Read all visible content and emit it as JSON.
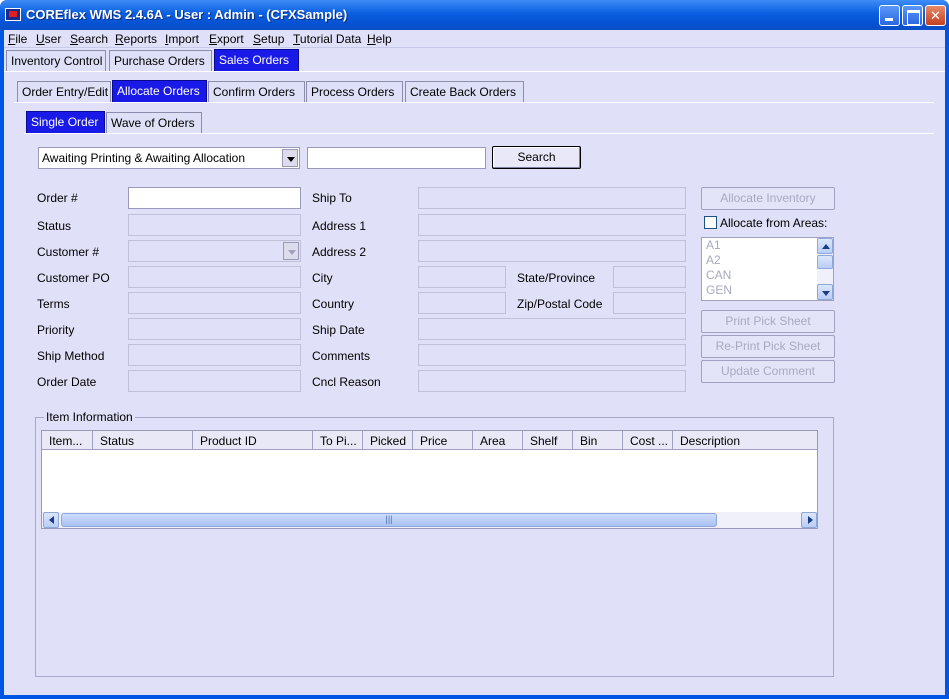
{
  "window": {
    "title": "COREflex WMS 2.4.6A - User : Admin - (CFXSample)"
  },
  "menu": [
    "File",
    "User",
    "Search",
    "Reports",
    "Import",
    "Export",
    "Setup",
    "Tutorial Data",
    "Help"
  ],
  "main_tabs": [
    "Inventory Control",
    "Purchase Orders",
    "Sales Orders"
  ],
  "sub_tabs": [
    "Order Entry/Edit",
    "Allocate Orders",
    "Confirm Orders",
    "Process Orders",
    "Create Back Orders"
  ],
  "mode_tabs": [
    "Single Order",
    "Wave of Orders"
  ],
  "search": {
    "filter_value": "Awaiting Printing & Awaiting Allocation",
    "query_value": "",
    "button": "Search"
  },
  "form": {
    "order_num": "Order #",
    "status": "Status",
    "customer_num": "Customer #",
    "customer_po": "Customer PO",
    "terms": "Terms",
    "priority": "Priority",
    "ship_method": "Ship Method",
    "order_date": "Order Date",
    "ship_to": "Ship To",
    "address1": "Address 1",
    "address2": "Address 2",
    "city": "City",
    "country": "Country",
    "ship_date": "Ship Date",
    "comments": "Comments",
    "cncl_reason": "Cncl Reason",
    "state": "State/Province",
    "zip": "Zip/Postal Code"
  },
  "actions": {
    "allocate_inventory": "Allocate Inventory",
    "allocate_from_areas": "Allocate from Areas:",
    "allocate_from_areas_checked": false,
    "print_pick": "Print Pick Sheet",
    "reprint_pick": "Re-Print Pick Sheet",
    "update_comment": "Update Comment"
  },
  "areas": [
    "A1",
    "A2",
    "CAN",
    "GEN"
  ],
  "items": {
    "group_label": "Item Information",
    "columns": [
      "Item...",
      "Status",
      "Product ID",
      "To Pi...",
      "Picked",
      "Price",
      "Area",
      "Shelf",
      "Bin",
      "Cost ...",
      "Description"
    ],
    "rows": []
  }
}
